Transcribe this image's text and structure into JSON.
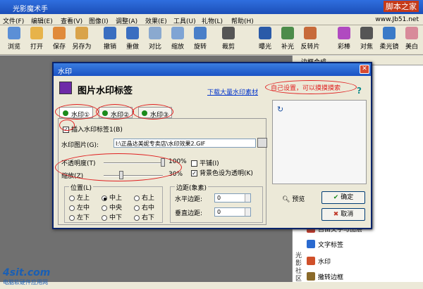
{
  "app": {
    "title": "光影魔术手",
    "site_badge": "脚本之家",
    "url": "www.Jb51.net"
  },
  "menu": [
    "文件(F)",
    "编辑(E)",
    "查看(V)",
    "图像(I)",
    "调整(A)",
    "效果(E)",
    "工具(U)",
    "礼物(L)",
    "帮助(H)"
  ],
  "toolbar": [
    "浏览",
    "打开",
    "保存",
    "另存为",
    "撤销",
    "重做",
    "对比",
    "缩放",
    "旋转",
    "裁剪",
    "曝光",
    "补光",
    "反转片",
    "彩棒",
    "对焦",
    "柔光镜",
    "美白"
  ],
  "right_panel": {
    "header": "边框合成",
    "side_label": "光影社区",
    "items": [
      "自由文字与图层",
      "文字标签",
      "水印",
      "撒转边框"
    ]
  },
  "dialog": {
    "title": "水印",
    "heading": "图片水印标签",
    "download_link": "下载大量水印素材",
    "annotation": "自己设置，可以摸摸摸索",
    "help": "?",
    "tabs": [
      "水印①",
      "水印②",
      "水印③"
    ],
    "insert_checkbox": "插入水印标签1(B)",
    "image_label": "水印图片(G):",
    "image_path": "I:\\正晶达美妮专卖店\\水印效果2.GIF",
    "opacity_label": "不透明度(T)",
    "opacity_value": "100%",
    "opacity_fraction": 1.0,
    "scale_label": "缩放(Z)",
    "scale_value": "30%",
    "scale_fraction": 0.3,
    "tile_label": "平铺(I)",
    "transparent_label": "背景色设为透明(K)",
    "position_label": "位置(L)",
    "positions": [
      "左上",
      "中上",
      "右上",
      "左中",
      "中央",
      "右中",
      "左下",
      "中下",
      "右下"
    ],
    "selected_position": "中上",
    "margin_label": "边距(象素)",
    "h_margin_label": "水平边距:",
    "h_margin_value": "0",
    "v_margin_label": "垂直边距:",
    "v_margin_value": "0",
    "preview_label": "预览",
    "ok_label": "确定",
    "cancel_label": "取消"
  },
  "logo": {
    "brand": "4sit.com",
    "tagline": "电脑软硬件应用网"
  },
  "colors": {
    "accent": "#1b53c4",
    "annotation": "#e02020",
    "link": "#0033cc"
  }
}
